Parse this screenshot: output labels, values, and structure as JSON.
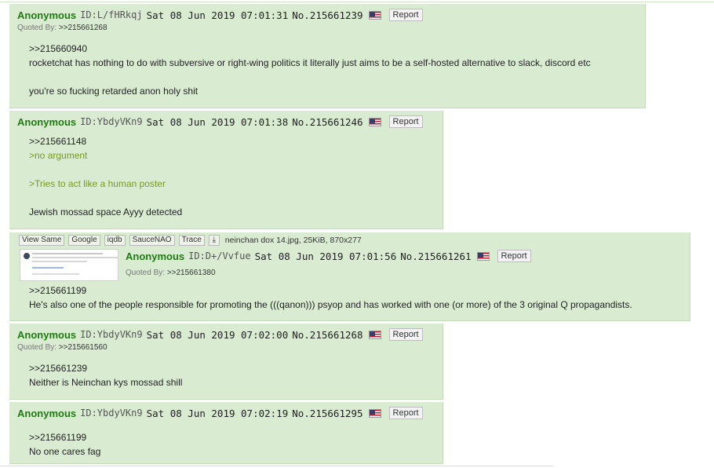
{
  "posts": [
    {
      "name": "Anonymous",
      "uid": "ID:L/fHRkqj",
      "date": "Sat 08 Jun 2019 07:01:31",
      "num": "No.215661239",
      "report": "Report",
      "quoted_label": "Quoted By:",
      "quoted": ">>215661268",
      "lines": [
        ">>215660940",
        "rocketchat has nothing to do with subversive or right-wing politics it literally just aims to be a self-hosted alternative to slack, discord etc",
        "you're so fucking retarded anon holy shit"
      ]
    },
    {
      "name": "Anonymous",
      "uid": "ID:YbdyVKn9",
      "date": "Sat 08 Jun 2019 07:01:38",
      "num": "No.215661246",
      "report": "Report",
      "lines": [
        ">>215661148",
        ">no argument",
        ">Tries to act like a human poster",
        "Jewish mossad space Ayyy detected"
      ]
    },
    {
      "name": "Anonymous",
      "uid": "ID:D+/Vvfue",
      "date": "Sat 08 Jun 2019 07:01:56",
      "num": "No.215661261",
      "report": "Report",
      "quoted_label": "Quoted By:",
      "quoted": ">>215661380",
      "file_buttons": [
        "View Same",
        "Google",
        "iqdb",
        "SauceNAO",
        "Trace"
      ],
      "download_icon": "download-icon",
      "file_info": "neinchan dox 14.jpg, 25KiB, 870x277",
      "lines": [
        ">>215661199",
        "He's also one of the people responsible for promoting the (((qanon))) psyop and has worked with one (or more) of the 3 original Q propagandists."
      ]
    },
    {
      "name": "Anonymous",
      "uid": "ID:YbdyVKn9",
      "date": "Sat 08 Jun 2019 07:02:00",
      "num": "No.215661268",
      "report": "Report",
      "quoted_label": "Quoted By:",
      "quoted": ">>215661560",
      "lines": [
        ">>215661239",
        "Neither is Neinchan kys mossad shill"
      ]
    },
    {
      "name": "Anonymous",
      "uid": "ID:YbdyVKn9",
      "date": "Sat 08 Jun 2019 07:02:19",
      "num": "No.215661295",
      "report": "Report",
      "lines": [
        ">>215661199",
        "No one cares fag"
      ]
    }
  ],
  "colors": {
    "post_bg": "#d9ecd2",
    "name": "#1f7b12",
    "greentext": "#789922"
  },
  "flag_icon": "us-flag-icon"
}
